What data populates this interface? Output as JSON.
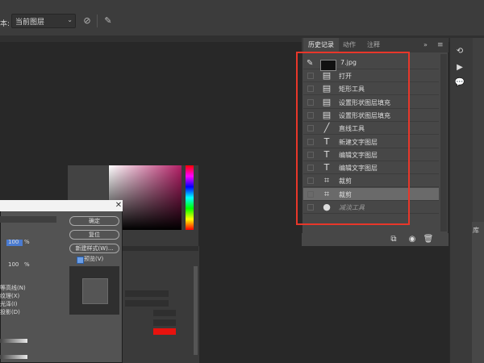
{
  "options_bar": {
    "sample_label": "本:",
    "sample_value": "当前图层",
    "icons": [
      "sample-all-layers-icon",
      "brush-pressure-icon"
    ]
  },
  "history_panel": {
    "tabs": [
      {
        "label": "历史记录",
        "active": true
      },
      {
        "label": "动作",
        "active": false
      },
      {
        "label": "注释",
        "active": false
      }
    ],
    "collapse_glyph": "»",
    "menu_glyph": "≡",
    "snapshot": {
      "name": "7.jpg"
    },
    "steps": [
      {
        "label": "打开",
        "icon": "document-icon",
        "selected": false,
        "dimmed": false
      },
      {
        "label": "矩形工具",
        "icon": "document-icon",
        "selected": false,
        "dimmed": false
      },
      {
        "label": "设置形状图层填充",
        "icon": "document-icon",
        "selected": false,
        "dimmed": false
      },
      {
        "label": "设置形状图层填充",
        "icon": "document-icon",
        "selected": false,
        "dimmed": false
      },
      {
        "label": "直线工具",
        "icon": "line-tool-icon",
        "selected": false,
        "dimmed": false
      },
      {
        "label": "新建文字图层",
        "icon": "type-tool-icon",
        "selected": false,
        "dimmed": false
      },
      {
        "label": "编辑文字图层",
        "icon": "type-tool-icon",
        "selected": false,
        "dimmed": false
      },
      {
        "label": "编辑文字图层",
        "icon": "type-tool-icon",
        "selected": false,
        "dimmed": false
      },
      {
        "label": "裁剪",
        "icon": "crop-tool-icon",
        "selected": false,
        "dimmed": false
      },
      {
        "label": "裁剪",
        "icon": "crop-tool-icon",
        "selected": true,
        "dimmed": false
      },
      {
        "label": "减淡工具",
        "icon": "dodge-tool-icon",
        "selected": false,
        "dimmed": true
      }
    ],
    "bottom_icons": [
      "new-document-from-state-icon",
      "new-snapshot-icon",
      "delete-icon"
    ],
    "highlight_color": "#e8372a"
  },
  "dialog": {
    "buttons": [
      "确定",
      "复位",
      "新建样式(W)..."
    ],
    "preview_label": "预览(V)",
    "preview_checked": true,
    "fragments": [
      "100",
      "%",
      "100",
      "%",
      "等高线(N)",
      "纹理(X)",
      "光泽(I)",
      "投影(D)"
    ]
  },
  "colors": {
    "fill_swatch": "#e8120e",
    "accent": "#6b9ee6"
  },
  "right_dock": {
    "icons": [
      "history-panel-icon",
      "play-action-icon",
      "comment-icon"
    ],
    "side_tab": "库"
  }
}
